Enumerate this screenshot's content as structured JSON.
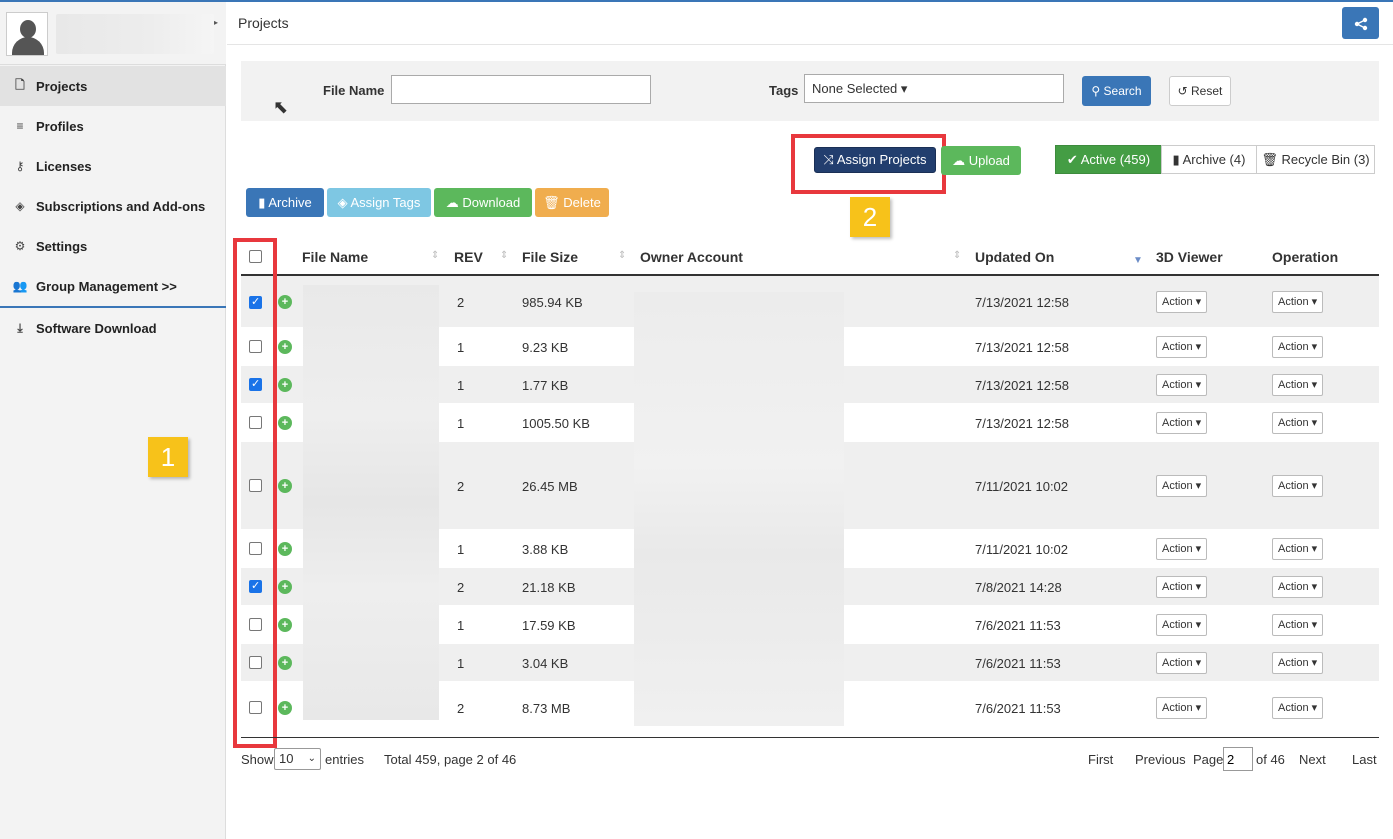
{
  "sidebar": {
    "items": [
      {
        "label": "Projects",
        "icon": "file-icon",
        "glyph": "🗋"
      },
      {
        "label": "Profiles",
        "icon": "database-icon",
        "glyph": "≡"
      },
      {
        "label": "Licenses",
        "icon": "key-icon",
        "glyph": "⚷"
      },
      {
        "label": "Subscriptions and Add-ons",
        "icon": "tags-icon",
        "glyph": "◈"
      },
      {
        "label": "Settings",
        "icon": "gear-icon",
        "glyph": "⚙"
      },
      {
        "label": "Group Management >>",
        "icon": "users-icon",
        "glyph": "👥"
      },
      {
        "label": "Software Download",
        "icon": "download-icon",
        "glyph": "⤓"
      }
    ]
  },
  "header": {
    "title": "Projects",
    "share_icon": "share-icon"
  },
  "filter": {
    "file_name_label": "File Name",
    "file_name_value": "",
    "tags_label": "Tags",
    "tags_value": "None Selected ▾",
    "search_label": "Search",
    "reset_label": "Reset"
  },
  "toolbar": {
    "assign_projects": "Assign Projects",
    "upload": "Upload",
    "active": "Active (459)",
    "archive_tab": "Archive (4)",
    "recycle_bin": "Recycle Bin (3)",
    "archive": "Archive",
    "assign_tags": "Assign Tags",
    "download": "Download",
    "delete": "Delete"
  },
  "annotations": {
    "one": "1",
    "two": "2"
  },
  "table": {
    "headers": {
      "file_name": "File Name",
      "rev": "REV",
      "file_size": "File Size",
      "owner": "Owner Account",
      "updated": "Updated On",
      "viewer": "3D Viewer",
      "operation": "Operation"
    },
    "action_label": "Action ▾",
    "rows": [
      {
        "checked": true,
        "rev": "2",
        "size": "985.94 KB",
        "updated": "7/13/2021 12:58"
      },
      {
        "checked": false,
        "rev": "1",
        "size": "9.23 KB",
        "updated": "7/13/2021 12:58"
      },
      {
        "checked": true,
        "rev": "1",
        "size": "1.77 KB",
        "updated": "7/13/2021 12:58"
      },
      {
        "checked": false,
        "rev": "1",
        "size": "1005.50 KB",
        "updated": "7/13/2021 12:58"
      },
      {
        "checked": false,
        "rev": "2",
        "size": "26.45 MB",
        "updated": "7/11/2021 10:02"
      },
      {
        "checked": false,
        "rev": "1",
        "size": "3.88 KB",
        "updated": "7/11/2021 10:02"
      },
      {
        "checked": true,
        "rev": "2",
        "size": "21.18 KB",
        "updated": "7/8/2021 14:28"
      },
      {
        "checked": false,
        "rev": "1",
        "size": "17.59 KB",
        "updated": "7/6/2021 11:53"
      },
      {
        "checked": false,
        "rev": "1",
        "size": "3.04 KB",
        "updated": "7/6/2021 11:53"
      },
      {
        "checked": false,
        "rev": "2",
        "size": "8.73 MB",
        "updated": "7/6/2021 11:53"
      }
    ]
  },
  "footer": {
    "show": "Show",
    "entries_value": "10",
    "entries": "entries",
    "total": "Total 459, page 2 of 46",
    "first": "First",
    "previous": "Previous",
    "page_label": "Page",
    "page_value": "2",
    "of_pages": "of 46",
    "next": "Next",
    "last": "Last"
  }
}
